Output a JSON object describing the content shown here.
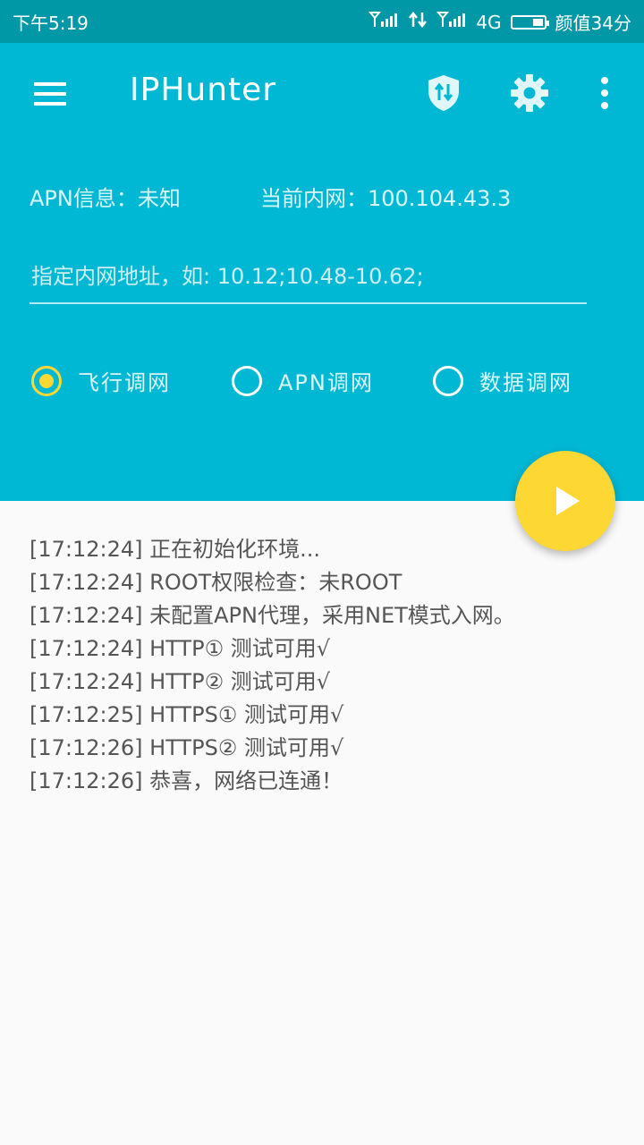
{
  "status_bar": {
    "time": "下午5:19",
    "network": "4G",
    "battery_text": "颜值34分",
    "battery_level": 0.34
  },
  "app_bar": {
    "title": "IPHunter",
    "icons": [
      "menu-icon",
      "shield-icon",
      "gear-icon",
      "more-vert-icon"
    ]
  },
  "info": {
    "apn": "APN信息：未知",
    "intranet": "当前内网：100.104.43.3"
  },
  "ip_input": {
    "value": "",
    "placeholder": "指定内网地址，如: 10.12;10.48-10.62;"
  },
  "modes": [
    {
      "label": "飞行调网",
      "checked": true
    },
    {
      "label": "APN调网",
      "checked": false
    },
    {
      "label": "数据调网",
      "checked": false
    }
  ],
  "fab": {
    "icon": "play-icon"
  },
  "log": [
    "[17:12:24] 正在初始化环境...",
    "[17:12:24] ROOT权限检查：未ROOT",
    "[17:12:24] 未配置APN代理，采用NET模式入网。",
    "[17:12:24] HTTP①  测试可用√",
    "[17:12:24] HTTP②  测试可用√",
    "[17:12:25] HTTPS① 测试可用√",
    "[17:12:26] HTTPS② 测试可用√",
    "[17:12:26] 恭喜，网络已连通！"
  ],
  "colors": {
    "primary": "#00b8d4",
    "status_bar": "#0097a7",
    "accent": "#fdd835",
    "log_text": "#555555"
  }
}
